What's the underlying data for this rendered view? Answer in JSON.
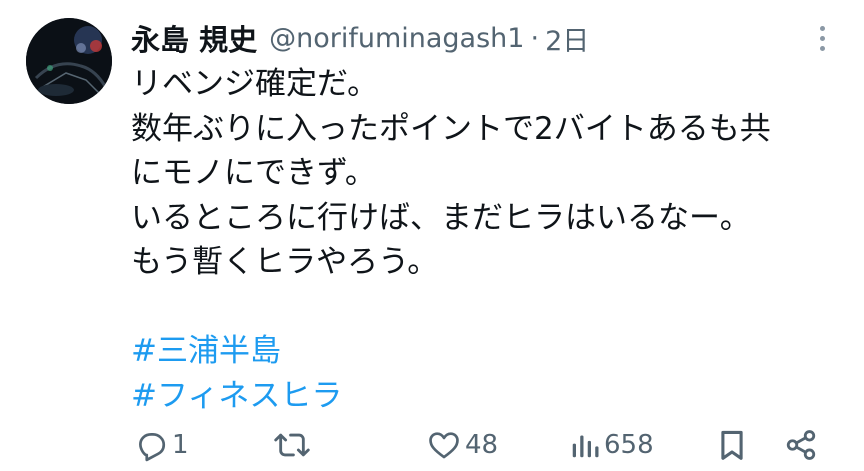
{
  "tweet": {
    "display_name": "永島 規史",
    "handle": "@norifuminagash1",
    "separator": "·",
    "time": "2日",
    "text_lines": [
      "リベンジ確定だ。",
      "数年ぶりに入ったポイントで2バイトあるも共",
      "にモノにできず。",
      "いるところに行けば、まだヒラはいるなー。",
      "もう暫くヒラやろう。"
    ],
    "hashtags": [
      "#三浦半島",
      "#フィネスヒラ"
    ]
  },
  "actions": {
    "reply_count": "1",
    "retweet_count": "",
    "like_count": "48",
    "views_count": "658"
  },
  "icons": {
    "reply": "reply-icon",
    "retweet": "retweet-icon",
    "like": "heart-icon",
    "views": "views-icon",
    "bookmark": "bookmark-icon",
    "share": "share-icon",
    "more": "more-icon"
  },
  "colors": {
    "text": "#0f1419",
    "secondary": "#536471",
    "link": "#1d9bf0"
  }
}
